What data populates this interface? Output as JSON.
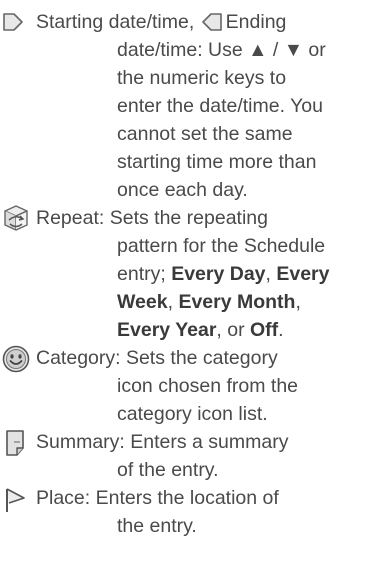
{
  "entries": [
    {
      "id": "datetime",
      "icon_name": "start-date-icon",
      "second_icon_name": "end-date-icon",
      "lines": [
        {
          "before": "Starting date/time, ",
          "after": "Ending"
        },
        "date/time: Use ▲ / ▼ or",
        "the numeric keys to",
        "enter the date/time. You",
        "cannot set the same",
        "starting time more than",
        "once each day."
      ]
    },
    {
      "id": "repeat",
      "icon_name": "repeat-icon",
      "lines": [
        "Repeat: Sets the repeating",
        "pattern for the Schedule",
        {
          "t1": "entry; ",
          "b1": "Every Day",
          "t2": ", ",
          "b2": "Every"
        },
        {
          "b1": "Week",
          "t1": ", ",
          "b2": "Every Month",
          "t2": ","
        },
        {
          "b1": "Every Year",
          "t1": ", or ",
          "b2": "Off",
          "t2": "."
        }
      ]
    },
    {
      "id": "category",
      "icon_name": "category-smiley-icon",
      "lines": [
        "Category: Sets the category",
        "icon chosen from the",
        "category icon list."
      ]
    },
    {
      "id": "summary",
      "icon_name": "summary-note-icon",
      "lines": [
        "Summary: Enters a summary",
        "of the entry."
      ]
    },
    {
      "id": "place",
      "icon_name": "place-flag-icon",
      "lines": [
        "Place: Enters the location of",
        "the entry."
      ]
    }
  ]
}
